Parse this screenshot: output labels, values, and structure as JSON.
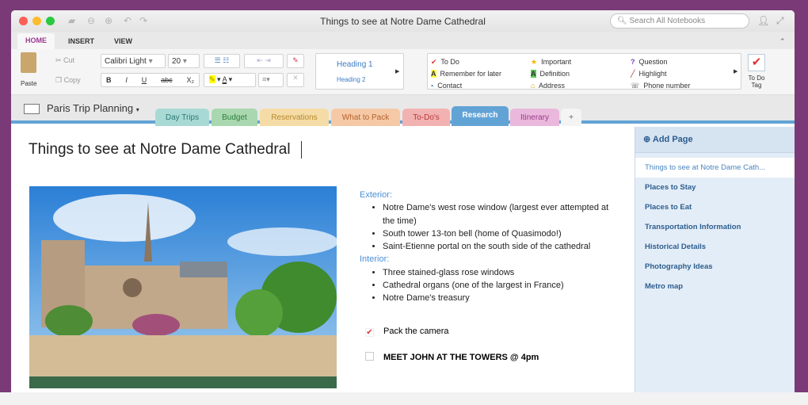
{
  "window": {
    "title": "Things to see at Notre Dame Cathedral",
    "search_placeholder": "Search All Notebooks"
  },
  "ribbon_tabs": [
    "HOME",
    "INSERT",
    "VIEW"
  ],
  "clipboard": {
    "paste": "Paste",
    "cut": "Cut",
    "copy": "Copy"
  },
  "font": {
    "name": "Calibri Light",
    "size": "20"
  },
  "format_buttons": {
    "bold": "B",
    "italic": "I",
    "underline": "U",
    "strike": "abc",
    "subscript": "X₂",
    "font_color": "A"
  },
  "styles": [
    "Heading 1",
    "Heading 2"
  ],
  "tags": [
    {
      "label": "To Do",
      "icon": "checkmark-icon"
    },
    {
      "label": "Remember for later",
      "icon": "yellow-a-icon"
    },
    {
      "label": "Contact",
      "icon": "contact-icon"
    },
    {
      "label": "Important",
      "icon": "star-icon"
    },
    {
      "label": "Definition",
      "icon": "green-a-icon"
    },
    {
      "label": "Address",
      "icon": "house-icon"
    },
    {
      "label": "Question",
      "icon": "question-icon"
    },
    {
      "label": "Highlight",
      "icon": "pen-icon"
    },
    {
      "label": "Phone number",
      "icon": "phone-icon"
    }
  ],
  "todo_tag_button": "To Do Tag",
  "notebook": "Paris Trip Planning",
  "sections": [
    {
      "label": "Day Trips",
      "color": "#a9d9d5",
      "text": "#2a7b74"
    },
    {
      "label": "Budget",
      "color": "#a9d8b0",
      "text": "#2f7d3c"
    },
    {
      "label": "Reservations",
      "color": "#f5dca6",
      "text": "#b58a2e"
    },
    {
      "label": "What to Pack",
      "color": "#f6c9a6",
      "text": "#b4612d"
    },
    {
      "label": "To-Do's",
      "color": "#f3b2b2",
      "text": "#b53a3a"
    },
    {
      "label": "Research",
      "color": "#62a3d6",
      "text": "#ffffff"
    },
    {
      "label": "Itinerary",
      "color": "#eab8dc",
      "text": "#9b3a8e"
    }
  ],
  "add_section": "+",
  "page": {
    "title": "Things to see at Notre Dame Cathedral",
    "exterior_heading": "Exterior:",
    "exterior": [
      "Notre Dame's west rose window (largest ever attempted at the time)",
      "South tower 13-ton bell (home of Quasimodo!)",
      "Saint-Etienne portal on the south side of the cathedral"
    ],
    "interior_heading": "Interior:",
    "interior": [
      "Three stained-glass rose windows",
      "Cathedral organs (one of the largest in France)",
      "Notre Dame's treasury"
    ],
    "todos": [
      {
        "label": "Pack the camera",
        "checked": true
      },
      {
        "label": "MEET JOHN AT THE TOWERS @ 4pm",
        "checked": false
      }
    ]
  },
  "pages": {
    "add_page": "Add Page",
    "items": [
      "Things to see at Notre Dame Cath...",
      "Places to Stay",
      "Places to Eat",
      "Transportation Information",
      "Historical Details",
      "Photography Ideas",
      "Metro map"
    ]
  }
}
